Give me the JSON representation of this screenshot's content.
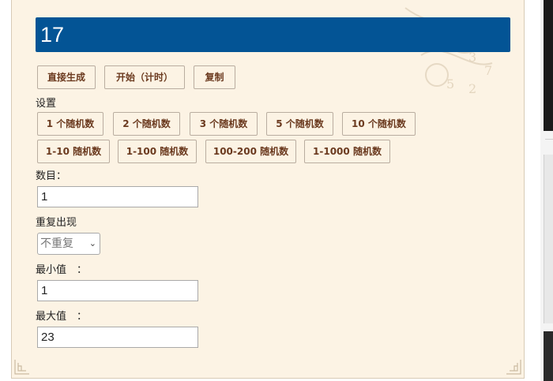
{
  "result": {
    "value": "17"
  },
  "actions": {
    "generate_label": "直接生成",
    "start_label": "开始（计时）",
    "copy_label": "复制"
  },
  "settings": {
    "heading": "设置",
    "count_presets": [
      "1 个随机数",
      "2 个随机数",
      "3 个随机数",
      "5 个随机数",
      "10 个随机数"
    ],
    "range_presets": [
      "1-10 随机数",
      "1-100 随机数",
      "100-200 随机数",
      "1-1000 随机数"
    ]
  },
  "form": {
    "count_label": "数目：",
    "count_value": "1",
    "repeat_label": "重复出现",
    "repeat_selected": "不重复",
    "min_label": "最小值　：",
    "min_value": "1",
    "max_label": "最大值　：",
    "max_value": "23"
  },
  "colors": {
    "result_bg": "#035495",
    "panel_bg": "#fcf3e4",
    "button_text": "#6b3a1f"
  },
  "icons": {
    "select_arrow": "chevron-down-icon"
  }
}
